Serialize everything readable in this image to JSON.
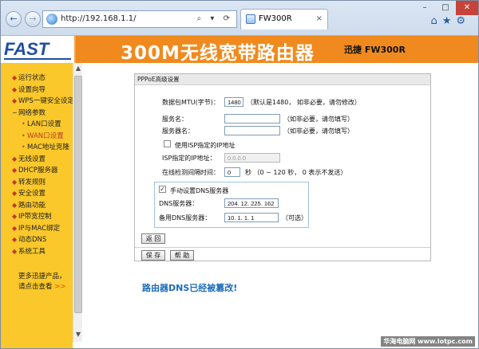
{
  "browser": {
    "url": "http://192.168.1.1/",
    "address_tools": "⌕ ▾ ⟳",
    "tab_title": "FW300R",
    "tab_close": "×",
    "back_glyph": "←",
    "forward_glyph": "→",
    "min_glyph": "–",
    "max_glyph": "□",
    "close_glyph": "✕",
    "toolbar_icons": "⌂★⚙"
  },
  "header": {
    "logo": "FAST",
    "title": "300M无线宽带路由器",
    "model": "迅捷 FW300R",
    "accent": "#f08a1e",
    "logo_color": "#1e4fa0"
  },
  "sidebar": {
    "bg": "#fac82a",
    "items": [
      {
        "label": "运行状态",
        "bullet": "◆"
      },
      {
        "label": "设置向导",
        "bullet": "◆"
      },
      {
        "label": "WPS一键安全设定",
        "bullet": "◆"
      },
      {
        "label": "网络参数",
        "bullet": "−"
      },
      {
        "label": "LAN口设置",
        "bullet": "•"
      },
      {
        "label": "WAN口设置",
        "bullet": "•"
      },
      {
        "label": "MAC地址克隆",
        "bullet": "•"
      },
      {
        "label": "无线设置",
        "bullet": "◆"
      },
      {
        "label": "DHCP服务器",
        "bullet": "◆"
      },
      {
        "label": "转发规则",
        "bullet": "◆"
      },
      {
        "label": "安全设置",
        "bullet": "◆"
      },
      {
        "label": "路由功能",
        "bullet": "◆"
      },
      {
        "label": "IP带宽控制",
        "bullet": "◆"
      },
      {
        "label": "IP与MAC绑定",
        "bullet": "◆"
      },
      {
        "label": "动态DNS",
        "bullet": "◆"
      },
      {
        "label": "系统工具",
        "bullet": "◆"
      }
    ],
    "more_line1": "更多迅捷产品，",
    "more_line2": "请点击查看",
    "more_arrow": ">>"
  },
  "panel": {
    "title": "PPPoE高级设置",
    "mtu_label": "数据包MTU(字节)：",
    "mtu_value": "1480",
    "mtu_note": "（默认是1480， 如非必要，请勿修改）",
    "service_label": "服务名：",
    "service_value": "",
    "service_note": "（如非必要，请勿填写）",
    "server_label": "服务器名：",
    "server_value": "",
    "server_note": "（如非必要，请勿填写）",
    "isp_ip_checkbox_label": "使用ISP指定的IP地址",
    "isp_ip_label": "ISP指定的IP地址：",
    "isp_ip_value": "0.0.0.0",
    "idle_label": "在线检测间隔时间：",
    "idle_value": "0",
    "idle_note": "秒 （0 ~ 120 秒， 0 表示不发送）",
    "dns_checkbox_label": "手动设置DNS服务器",
    "dns_checkbox_mark": "✓",
    "dns1_label": "DNS服务器：",
    "dns1_value": "204. 12. 225. 162",
    "dns2_label": "备用DNS服务器：",
    "dns2_value": "10. 1. 1. 1",
    "dns2_note": "（可选）",
    "back_button": "返 回",
    "save_button": "保 存",
    "help_button": "帮 助"
  },
  "alert": "路由器DNS已经被篡改!",
  "watermark": "华海电脑网 www.lotpc.com"
}
